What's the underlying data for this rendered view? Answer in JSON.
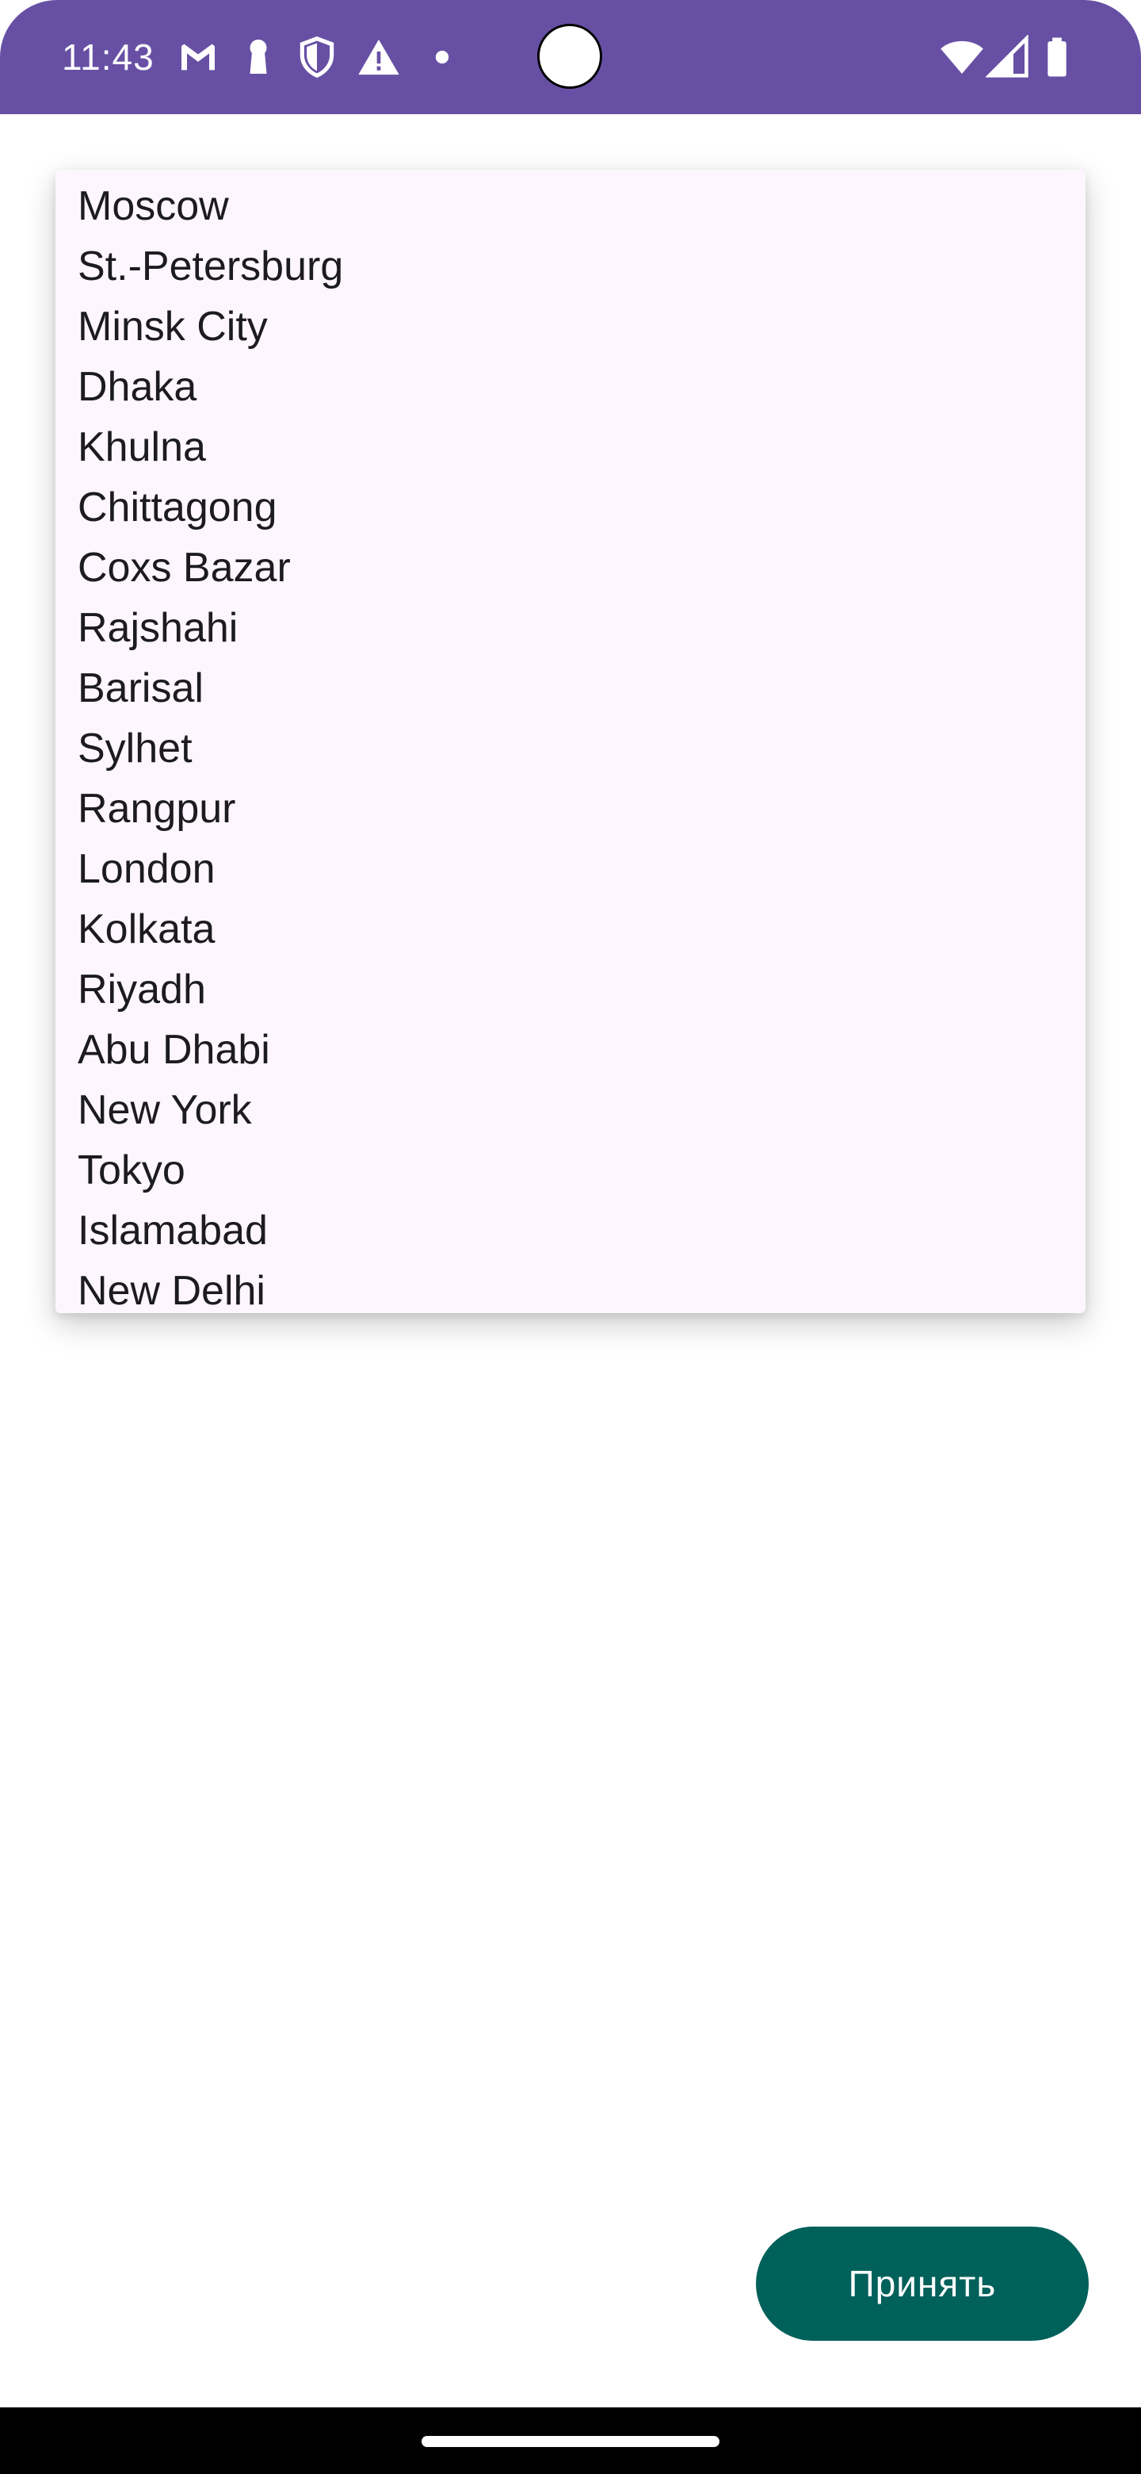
{
  "status_bar": {
    "time": "11:43",
    "background_color": "#6750A4",
    "left_icons": [
      "gmail-icon",
      "keyhole-icon",
      "shield-icon",
      "warning-icon",
      "dot-icon"
    ],
    "right_icons": [
      "wifi-icon",
      "cell-signal-icon",
      "battery-icon"
    ]
  },
  "dropdown": {
    "items": [
      "Moscow",
      "St.-Petersburg",
      "Minsk City",
      "Dhaka",
      "Khulna",
      "Chittagong",
      "Coxs Bazar",
      "Rajshahi",
      "Barisal",
      "Sylhet",
      "Rangpur",
      "London",
      "Kolkata",
      "Riyadh",
      "Abu Dhabi",
      "New York",
      "Tokyo",
      "Islamabad",
      "New Delhi"
    ],
    "background_color": "#FDF6FE"
  },
  "actions": {
    "accept_label": "Принять",
    "accept_color": "#00605A"
  }
}
